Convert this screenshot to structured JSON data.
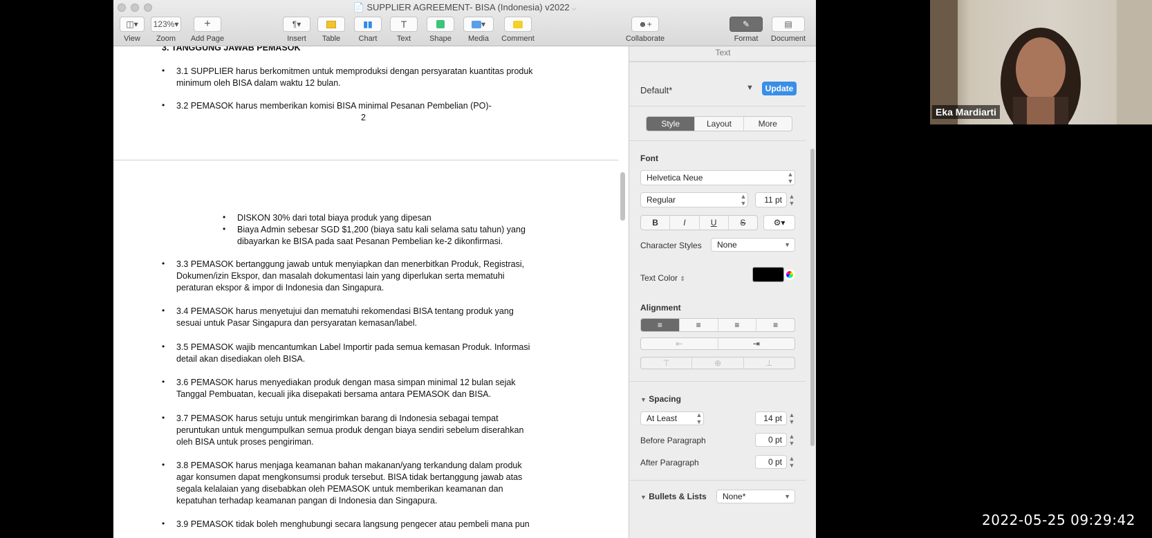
{
  "window": {
    "title": "SUPPLIER AGREEMENT- BISA (Indonesia) v2022"
  },
  "toolbar": {
    "view_label": "View",
    "zoom_value": "123%",
    "zoom_label": "Zoom",
    "add_page_label": "Add Page",
    "insert_label": "Insert",
    "table_label": "Table",
    "chart_label": "Chart",
    "text_label": "Text",
    "shape_label": "Shape",
    "media_label": "Media",
    "comment_label": "Comment",
    "collaborate_label": "Collaborate",
    "format_label": "Format",
    "document_label": "Document"
  },
  "document": {
    "heading": "3. TANGGUNG JAWAB PEMASOK",
    "lines": {
      "l31a": "3.1  SUPPLIER harus berkomitmen untuk memproduksi dengan persyaratan kuantitas produk",
      "l31b": "minimum oleh BISA dalam waktu 12 bulan.",
      "l32a": "3.2  PEMASOK harus memberikan komisi BISA minimal Pesanan Pembelian (PO)-",
      "page_number": "2",
      "sub1": "DISKON 30% dari total biaya produk yang dipesan",
      "sub2a": "Biaya Admin sebesar SGD $1,200 (biaya satu kali selama satu tahun) yang",
      "sub2b": "dibayarkan ke BISA pada saat Pesanan Pembelian ke-2 dikonfirmasi.",
      "l33a": "3.3 PEMASOK bertanggung jawab untuk menyiapkan dan menerbitkan Produk, Registrasi,",
      "l33b": "Dokumen/izin Ekspor, dan masalah dokumentasi lain yang diperlukan serta mematuhi",
      "l33c": "peraturan ekspor & impor di Indonesia dan Singapura.",
      "l34a": "3.4 PEMASOK harus menyetujui dan mematuhi rekomendasi BISA tentang produk yang",
      "l34b": "sesuai untuk Pasar Singapura dan persyaratan kemasan/label.",
      "l35a": "3.5 PEMASOK wajib mencantumkan Label Importir pada semua kemasan Produk. Informasi",
      "l35b": "detail akan disediakan oleh BISA.",
      "l36a": "3.6 PEMASOK harus menyediakan produk dengan masa simpan minimal 12 bulan sejak",
      "l36b": "Tanggal Pembuatan, kecuali jika disepakati bersama antara PEMASOK dan BISA.",
      "l37a": "3.7 PEMASOK harus setuju untuk mengirimkan barang di Indonesia sebagai tempat",
      "l37b": "peruntukan untuk mengumpulkan semua produk dengan biaya sendiri sebelum diserahkan",
      "l37c": "oleh BISA untuk proses pengiriman.",
      "l38a": "3.8 PEMASOK harus menjaga keamanan bahan makanan/yang terkandung dalam produk",
      "l38b": "agar konsumen dapat mengkonsumsi produk tersebut. BISA tidak bertanggung jawab atas",
      "l38c": "segala kelalaian yang disebabkan oleh PEMASOK untuk memberikan keamanan dan",
      "l38d": "kepatuhan terhadap keamanan pangan di Indonesia dan Singapura.",
      "l39a": "3.9 PEMASOK tidak boleh menghubungi secara langsung pengecer atau pembeli mana pun"
    }
  },
  "inspector": {
    "tab_title": "Text",
    "paragraph_style": "Default*",
    "update_button": "Update",
    "tabs": [
      "Style",
      "Layout",
      "More"
    ],
    "font_heading": "Font",
    "font_family": "Helvetica Neue",
    "font_style": "Regular",
    "font_size": "11 pt",
    "bold": "B",
    "italic": "I",
    "underline": "U",
    "strike": "S",
    "character_styles_label": "Character Styles",
    "character_styles_value": "None",
    "text_color_label": "Text Color",
    "text_color_value": "#000000",
    "alignment_heading": "Alignment",
    "spacing_heading": "Spacing",
    "spacing_mode": "At Least",
    "spacing_value": "14 pt",
    "before_paragraph_label": "Before Paragraph",
    "before_paragraph_value": "0 pt",
    "after_paragraph_label": "After Paragraph",
    "after_paragraph_value": "0 pt",
    "bullets_label": "Bullets & Lists",
    "bullets_value": "None*"
  },
  "video": {
    "participant_name": "Eka Mardiarti"
  },
  "overlay": {
    "timestamp": "2022-05-25 09:29:42"
  }
}
